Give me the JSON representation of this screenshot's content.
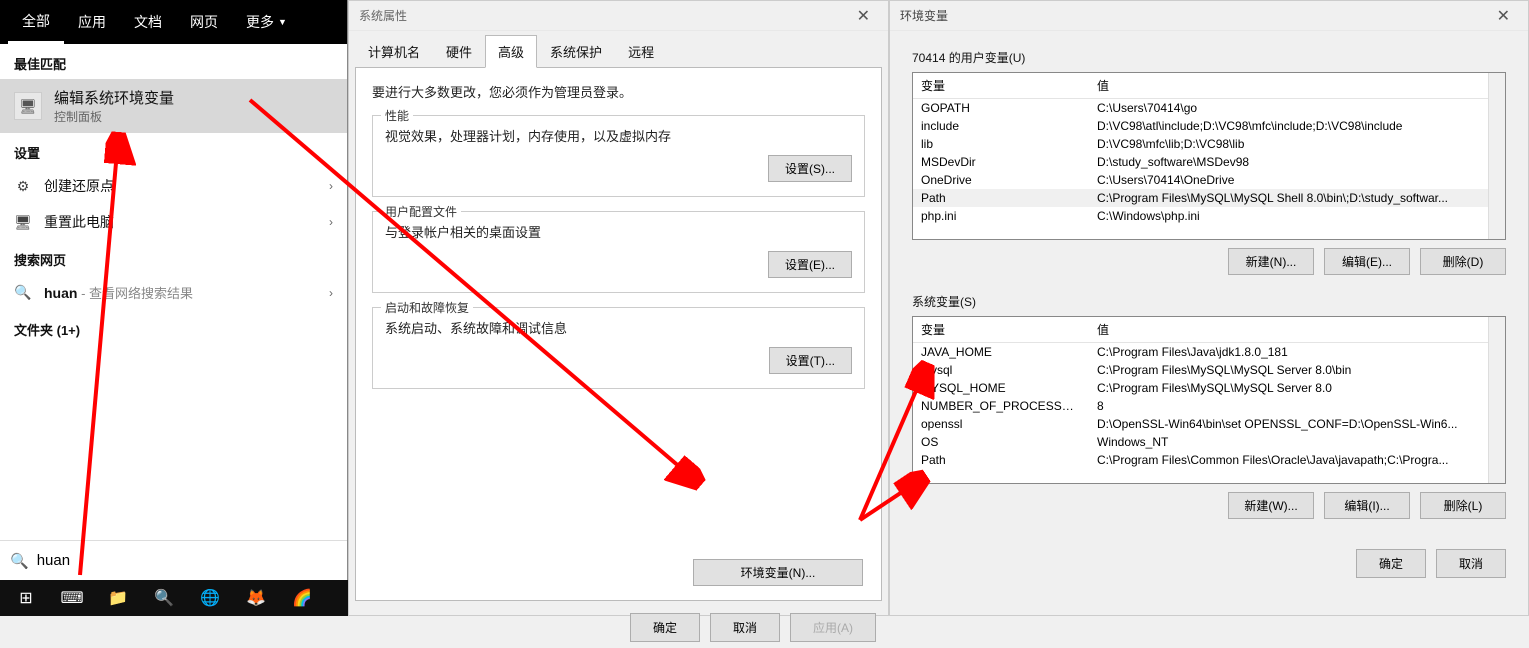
{
  "search": {
    "tabs": {
      "all": "全部",
      "apps": "应用",
      "docs": "文档",
      "web": "网页",
      "more": "更多"
    },
    "section_best": "最佳匹配",
    "best_match": {
      "title": "编辑系统环境变量",
      "sub": "控制面板"
    },
    "section_settings": "设置",
    "settings_items": [
      {
        "icon": "⚙",
        "label": "创建还原点"
      },
      {
        "icon": "🖥",
        "label": "重置此电脑"
      }
    ],
    "section_web": "搜索网页",
    "web_item": {
      "prefix": "huan",
      "hint": " - 查看网络搜索结果"
    },
    "section_folders": "文件夹 (1+)",
    "input_value": "huan"
  },
  "taskbar": {
    "items": [
      "⊞",
      "⌨",
      "📁",
      "🔍",
      "🌐",
      "🦊",
      "🌈"
    ]
  },
  "sysprops": {
    "title": "系统属性",
    "tabs": {
      "computer": "计算机名",
      "hardware": "硬件",
      "advanced": "高级",
      "protect": "系统保护",
      "remote": "远程"
    },
    "note": "要进行大多数更改，您必须作为管理员登录。",
    "perf": {
      "title": "性能",
      "desc": "视觉效果，处理器计划，内存使用，以及虚拟内存",
      "btn": "设置(S)..."
    },
    "user": {
      "title": "用户配置文件",
      "desc": "与登录帐户相关的桌面设置",
      "btn": "设置(E)..."
    },
    "boot": {
      "title": "启动和故障恢复",
      "desc": "系统启动、系统故障和调试信息",
      "btn": "设置(T)..."
    },
    "envbtn": "环境变量(N)...",
    "ok": "确定",
    "cancel": "取消",
    "apply": "应用(A)"
  },
  "envvars": {
    "title": "环境变量",
    "user_label": "70414 的用户变量(U)",
    "col_var": "变量",
    "col_val": "值",
    "user_vars": [
      {
        "k": "GOPATH",
        "v": "C:\\Users\\70414\\go"
      },
      {
        "k": "include",
        "v": "D:\\VC98\\atl\\include;D:\\VC98\\mfc\\include;D:\\VC98\\include"
      },
      {
        "k": "lib",
        "v": "D:\\VC98\\mfc\\lib;D:\\VC98\\lib"
      },
      {
        "k": "MSDevDir",
        "v": "D:\\study_software\\MSDev98"
      },
      {
        "k": "OneDrive",
        "v": "C:\\Users\\70414\\OneDrive"
      },
      {
        "k": "Path",
        "v": "C:\\Program Files\\MySQL\\MySQL Shell 8.0\\bin\\;D:\\study_softwar...",
        "sel": true
      },
      {
        "k": "php.ini",
        "v": "C:\\Windows\\php.ini"
      }
    ],
    "user_btns": {
      "new": "新建(N)...",
      "edit": "编辑(E)...",
      "del": "删除(D)"
    },
    "sys_label": "系统变量(S)",
    "sys_vars": [
      {
        "k": "JAVA_HOME",
        "v": "C:\\Program Files\\Java\\jdk1.8.0_181"
      },
      {
        "k": "mysql",
        "v": "C:\\Program Files\\MySQL\\MySQL Server 8.0\\bin"
      },
      {
        "k": "MYSQL_HOME",
        "v": "C:\\Program Files\\MySQL\\MySQL Server 8.0"
      },
      {
        "k": "NUMBER_OF_PROCESSORS",
        "v": "8"
      },
      {
        "k": "openssl",
        "v": "D:\\OpenSSL-Win64\\bin\\set OPENSSL_CONF=D:\\OpenSSL-Win6..."
      },
      {
        "k": "OS",
        "v": "Windows_NT"
      },
      {
        "k": "Path",
        "v": "C:\\Program Files\\Common Files\\Oracle\\Java\\javapath;C:\\Progra..."
      }
    ],
    "sys_btns": {
      "new": "新建(W)...",
      "edit": "编辑(I)...",
      "del": "删除(L)"
    },
    "ok": "确定",
    "cancel": "取消"
  }
}
